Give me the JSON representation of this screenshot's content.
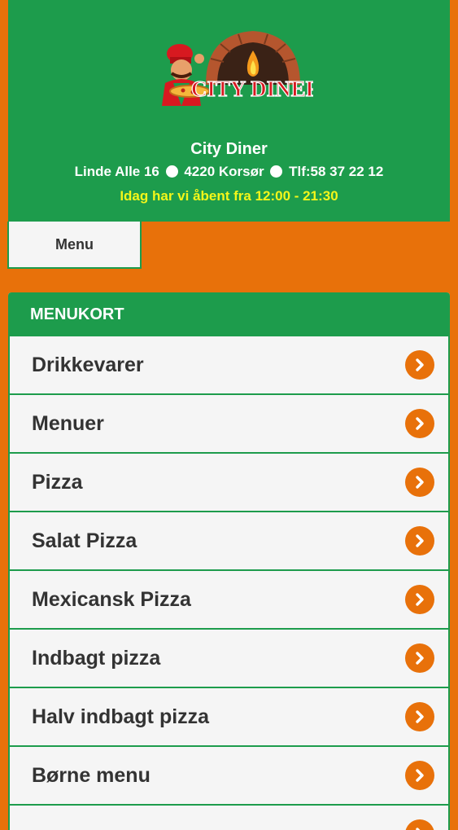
{
  "header": {
    "logo_text": "CITY DINER",
    "name": "City Diner",
    "address": "Linde Alle 16",
    "city": "4220 Korsør",
    "phone": "Tlf:58 37 22 12",
    "hours": "Idag har vi åbent fra 12:00 - 21:30"
  },
  "nav": {
    "menu_label": "Menu"
  },
  "menukort": {
    "title": "MENUKORT",
    "items": [
      {
        "label": "Drikkevarer"
      },
      {
        "label": "Menuer"
      },
      {
        "label": "Pizza"
      },
      {
        "label": "Salat Pizza"
      },
      {
        "label": "Mexicansk Pizza"
      },
      {
        "label": "Indbagt pizza"
      },
      {
        "label": "Halv indbagt pizza"
      },
      {
        "label": "Børne menu"
      },
      {
        "label": ""
      }
    ]
  },
  "colors": {
    "green": "#1d9c4c",
    "orange": "#e8710a",
    "yellow": "#f3f61a"
  },
  "icons": {
    "item_arrow": "chevron-right-icon"
  }
}
